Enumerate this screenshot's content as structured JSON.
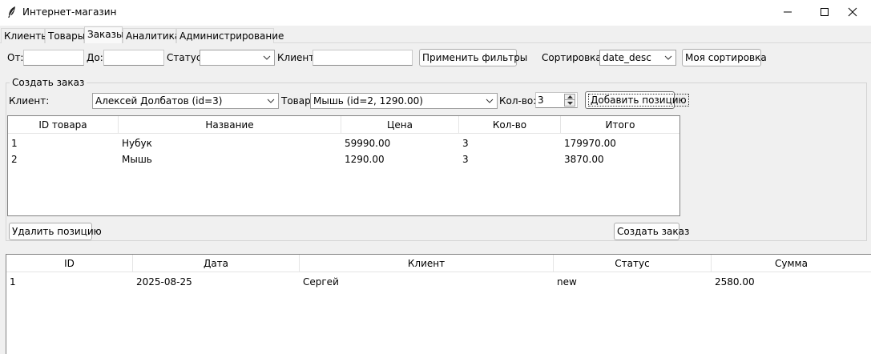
{
  "window": {
    "title": "Интернет-магазин"
  },
  "tabs": [
    {
      "label": "Клиенты"
    },
    {
      "label": "Товары"
    },
    {
      "label": "Заказы"
    },
    {
      "label": "Аналитика"
    },
    {
      "label": "Администрирование"
    }
  ],
  "filters": {
    "from_label": "От:",
    "from_value": "",
    "to_label": "До:",
    "to_value": "",
    "status_label": "Статус:",
    "status_value": "",
    "client_label": "Клиент:",
    "client_value": "",
    "apply_button": "Применить фильтры",
    "sort_label": "Сортировка:",
    "sort_value": "date_desc",
    "my_sort_button": "Моя сортировка"
  },
  "create_order": {
    "group_title": "Создать заказ",
    "client_label": "Клиент:",
    "client_value": "Алексей Долбатов (id=3)",
    "product_label": "Товар:",
    "product_value": "Мышь (id=2, 1290.00)",
    "qty_label": "Кол-во:",
    "qty_value": "3",
    "add_button": "Добавить позицию",
    "remove_button": "Удалить позицию",
    "create_button": "Создать заказ",
    "items_table": {
      "columns": [
        "ID товара",
        "Название",
        "Цена",
        "Кол-во",
        "Итого"
      ],
      "rows": [
        [
          "1",
          "Нубук",
          "59990.00",
          "3",
          "179970.00"
        ],
        [
          "2",
          "Мышь",
          "1290.00",
          "3",
          "3870.00"
        ]
      ]
    }
  },
  "orders_table": {
    "columns": [
      "ID",
      "Дата",
      "Клиент",
      "Статус",
      "Сумма"
    ],
    "rows": [
      [
        "1",
        "2025-08-25",
        "Сергей",
        "new",
        "2580.00"
      ]
    ]
  },
  "icons": {
    "app": "feather-icon",
    "minimize": "minimize-icon",
    "maximize": "maximize-icon",
    "close": "close-icon",
    "dropdown": "chevron-down-icon"
  }
}
